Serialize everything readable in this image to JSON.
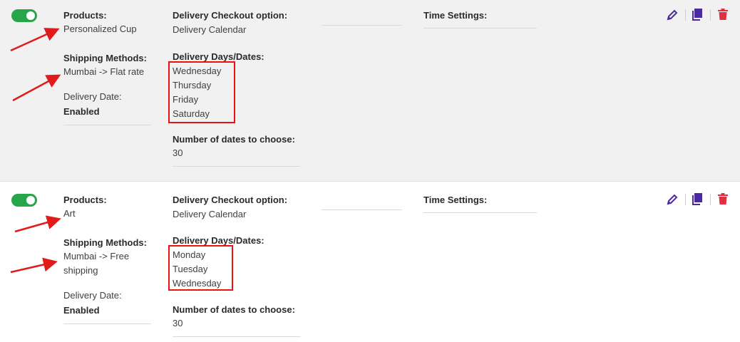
{
  "colors": {
    "toggle_on": "#27a54a",
    "accent_icon": "#4b2aa0",
    "delete_icon": "#e03040",
    "annotation": "#e11a1a"
  },
  "labels": {
    "products": "Products:",
    "shipping_methods": "Shipping Methods:",
    "delivery_date": "Delivery Date:",
    "delivery_checkout_option": "Delivery Checkout option:",
    "delivery_days": "Delivery Days/Dates:",
    "number_of_dates": "Number of dates to choose:",
    "time_settings": "Time Settings:"
  },
  "rules": [
    {
      "enabled": true,
      "product": "Personalized Cup",
      "shipping_method": "Mumbai -> Flat rate",
      "delivery_date_status": "Enabled",
      "checkout_option": "Delivery Calendar",
      "days": [
        "Wednesday",
        "Thursday",
        "Friday",
        "Saturday"
      ],
      "number_of_dates": "30",
      "icons": [
        "edit-icon",
        "duplicate-icon",
        "delete-icon"
      ]
    },
    {
      "enabled": true,
      "product": "Art",
      "shipping_method_line1": "Mumbai -> Free",
      "shipping_method_line2": "shipping",
      "delivery_date_status": "Enabled",
      "checkout_option": "Delivery Calendar",
      "days": [
        "Monday",
        "Tuesday",
        "Wednesday"
      ],
      "number_of_dates": "30",
      "icons": [
        "edit-icon",
        "duplicate-icon",
        "delete-icon"
      ]
    }
  ]
}
